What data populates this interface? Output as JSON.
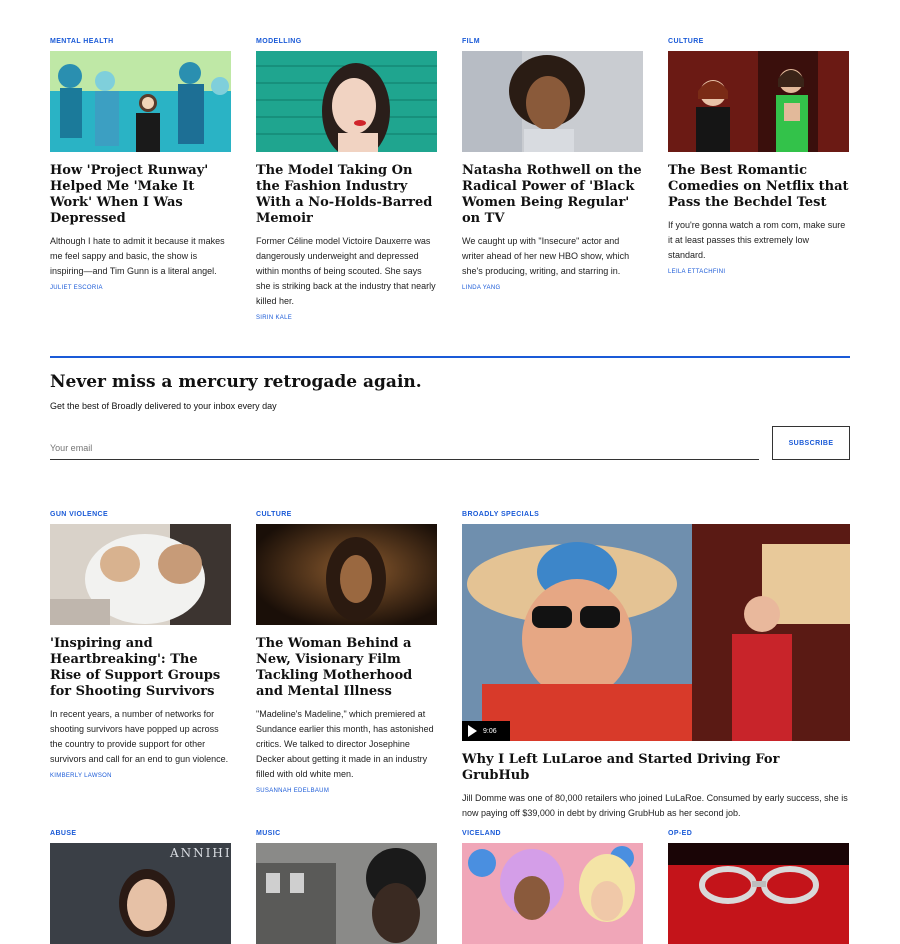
{
  "row1": [
    {
      "category": "MENTAL HEALTH",
      "title": "How 'Project Runway' Helped Me 'Make It Work' When I Was Depressed",
      "dek": "Although I hate to admit it because it makes me feel sappy and basic, the show is inspiring—and Tim Gunn is a literal angel.",
      "byline": "JULIET ESCORIA"
    },
    {
      "category": "MODELLING",
      "title": "The Model Taking On the Fashion Industry With a No-Holds-Barred Memoir",
      "dek": "Former Céline model Victoire Dauxerre was dangerously underweight and depressed within months of being scouted. She says she is striking back at the industry that nearly killed her.",
      "byline": "SIRIN KALE"
    },
    {
      "category": "FILM",
      "title": "Natasha Rothwell on the Radical Power of 'Black Women Being Regular' on TV",
      "dek": "We caught up with \"Insecure\" actor and writer ahead of her new HBO show, which she's producing, writing, and starring in.",
      "byline": "LINDA YANG"
    },
    {
      "category": "CULTURE",
      "title": "The Best Romantic Comedies on Netflix that Pass the Bechdel Test",
      "dek": "If you're gonna watch a rom com, make sure it at least passes this extremely low standard.",
      "byline": "LEILA ETTACHFINI"
    }
  ],
  "newsletter": {
    "heading": "Never miss a mercury retrogade again.",
    "subheading": "Get the best of Broadly delivered to your inbox every day",
    "placeholder": "Your email",
    "button": "SUBSCRIBE"
  },
  "row2": [
    {
      "category": "GUN VIOLENCE",
      "title": "'Inspiring and Heartbreaking': The Rise of Support Groups for Shooting Survivors",
      "dek": "In recent years, a number of networks for shooting survivors have popped up across the country to provide support for other survivors and call for an end to gun violence.",
      "byline": "KIMBERLY LAWSON"
    },
    {
      "category": "CULTURE",
      "title": "The Woman Behind a New, Visionary Film Tackling Motherhood and Mental Illness",
      "dek": "\"Madeline's Madeline,\" which premiered at Sundance earlier this month, has astonished critics. We talked to director Josephine Decker about getting it made in an industry filled with old white men.",
      "byline": "SUSANNAH EDELBAUM"
    }
  ],
  "feature": {
    "category": "BROADLY SPECIALS",
    "duration": "9:06",
    "title": "Why I Left LuLaroe and Started Driving For GrubHub",
    "dek": "Jill Domme was one of 80,000 retailers who joined LuLaRoe. Consumed by early success, she is now paying off $39,000 in debt by driving GrubHub as her second job."
  },
  "row3": [
    {
      "category": "ABUSE",
      "image_text": "ANNIHI"
    },
    {
      "category": "MUSIC"
    },
    {
      "category": "VICELAND"
    },
    {
      "category": "OP-ED"
    }
  ],
  "colors": {
    "accent": "#1a5ad7"
  }
}
